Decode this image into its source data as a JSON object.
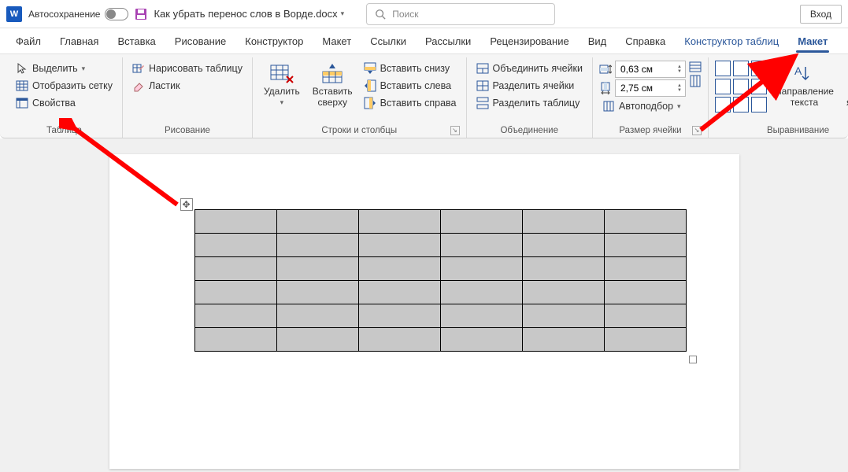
{
  "titlebar": {
    "autosave_label": "Автосохранение",
    "doc_title": "Как убрать перенос слов в Ворде.docx",
    "search_placeholder": "Поиск",
    "login_label": "Вход"
  },
  "tabs": {
    "file": "Файл",
    "home": "Главная",
    "insert": "Вставка",
    "draw": "Рисование",
    "design": "Конструктор",
    "layout": "Макет",
    "references": "Ссылки",
    "mailings": "Рассылки",
    "review": "Рецензирование",
    "view": "Вид",
    "help": "Справка",
    "table_design": "Конструктор таблиц",
    "table_layout": "Макет"
  },
  "ribbon": {
    "table": {
      "select": "Выделить",
      "gridlines": "Отобразить сетку",
      "properties": "Свойства",
      "group_label": "Таблица"
    },
    "draw": {
      "draw_table": "Нарисовать таблицу",
      "eraser": "Ластик",
      "group_label": "Рисование"
    },
    "rows_cols": {
      "delete": "Удалить",
      "insert_above": "Вставить сверху",
      "insert_below": "Вставить снизу",
      "insert_left": "Вставить слева",
      "insert_right": "Вставить справа",
      "group_label": "Строки и столбцы"
    },
    "merge": {
      "merge_cells": "Объединить ячейки",
      "split_cells": "Разделить ячейки",
      "split_table": "Разделить таблицу",
      "group_label": "Объединение"
    },
    "cell_size": {
      "height_value": "0,63 см",
      "width_value": "2,75 см",
      "autofit": "Автоподбор",
      "group_label": "Размер ячейки"
    },
    "alignment": {
      "text_direction": "Направление текста",
      "cell_margins": "Поля ячейки",
      "group_label": "Выравнивание"
    }
  },
  "table_data": {
    "rows": 6,
    "cols": 6
  }
}
